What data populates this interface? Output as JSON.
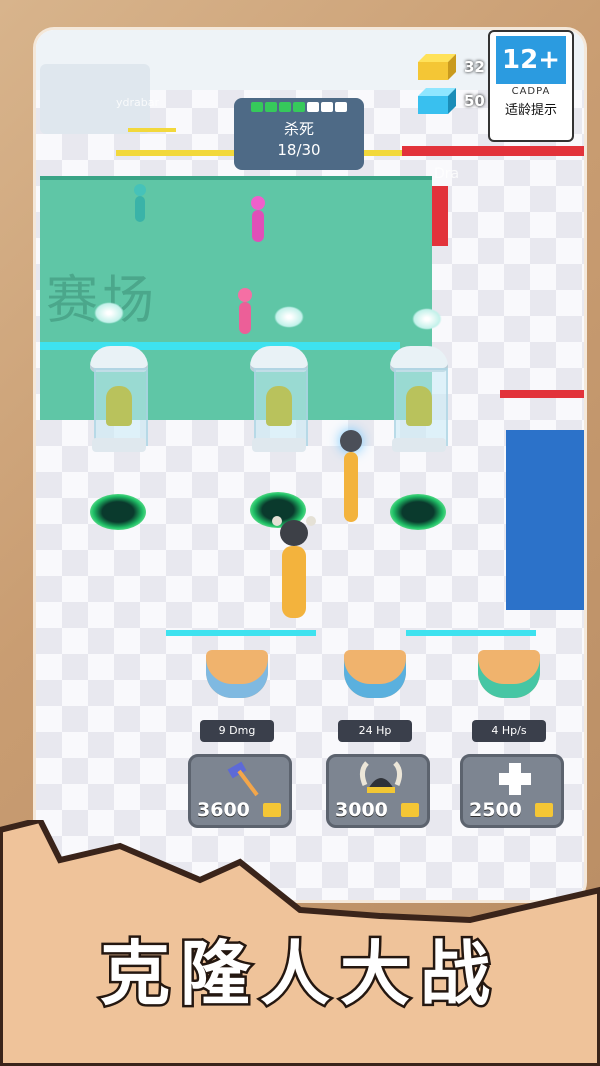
{
  "hud": {
    "kill_title": "杀死",
    "kill_count": "18/30",
    "kill_progress": 0.6,
    "res_gold": "32",
    "res_blue": "50"
  },
  "rating": {
    "age": "12+",
    "org": "CADPA",
    "tip": "适龄提示"
  },
  "arena": {
    "floor_label": "赛场",
    "player_tag_1": "ydrabar",
    "player_tag_2": "Dra"
  },
  "shop": [
    {
      "stat": "9 Dmg",
      "price": "3600",
      "icon": "hammer-icon"
    },
    {
      "stat": "24 Hp",
      "price": "3000",
      "icon": "viking-helmet-icon"
    },
    {
      "stat": "4 Hp/s",
      "price": "2500",
      "icon": "plus-icon"
    }
  ],
  "headline": "克隆人大战",
  "colors": {
    "arena_green": "#5fc6a6",
    "accent_blue": "#3ee2ef",
    "wall_red": "#e2333b",
    "coin_gold": "#f4c635"
  }
}
